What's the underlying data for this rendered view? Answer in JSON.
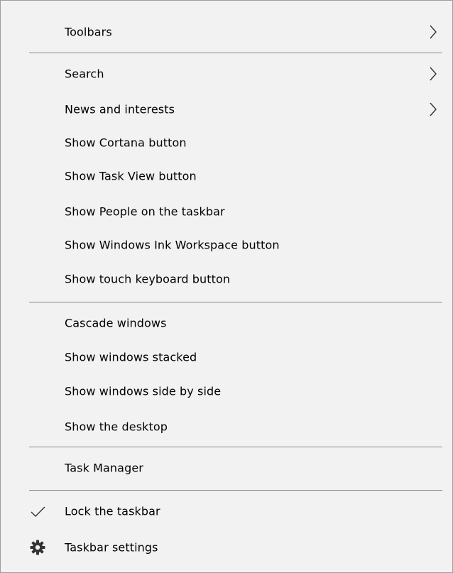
{
  "menu": {
    "toolbars": {
      "label": "Toolbars",
      "icon": "chevron-right-icon"
    },
    "search": {
      "label": "Search",
      "icon": "chevron-right-icon"
    },
    "news": {
      "label": "News and interests",
      "icon": "chevron-right-icon"
    },
    "cortana": {
      "label": "Show Cortana button"
    },
    "task_view": {
      "label": "Show Task View button"
    },
    "people": {
      "label": "Show People on the taskbar"
    },
    "ink": {
      "label": "Show Windows Ink Workspace button"
    },
    "touch_keyboard": {
      "label": "Show touch keyboard button"
    },
    "cascade": {
      "label": "Cascade windows"
    },
    "stacked": {
      "label": "Show windows stacked"
    },
    "side_by_side": {
      "label": "Show windows side by side"
    },
    "desktop": {
      "label": "Show the desktop"
    },
    "task_manager": {
      "label": "Task Manager"
    },
    "lock": {
      "label": "Lock the taskbar",
      "checked": true,
      "icon": "checkmark-icon"
    },
    "settings": {
      "label": "Taskbar settings",
      "icon": "gear-icon"
    }
  },
  "colors": {
    "menu_background": "#f2f2f2",
    "menu_border": "#9c9c9c",
    "separator": "#8a8a8a",
    "text": "#000000",
    "icon": "#333333"
  }
}
